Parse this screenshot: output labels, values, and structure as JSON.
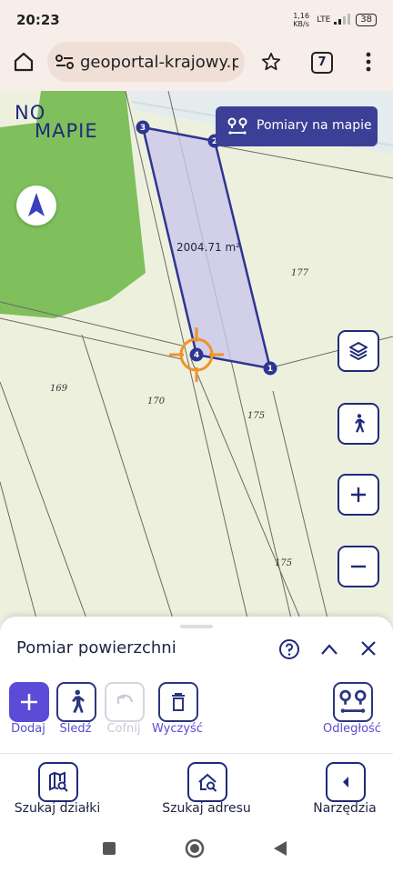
{
  "status_bar": {
    "time": "20:23",
    "net_speed": "1,16 KB/s",
    "network": "LTE",
    "battery": "38"
  },
  "browser": {
    "url": "geoportal-krajowy.pl/i",
    "tab_count": "7"
  },
  "map": {
    "logo_top": "NO",
    "logo_bottom": "MAPIE",
    "measure_button_label": "Pomiary na mapie",
    "area_label": "2004.71 m²",
    "vertex_labels": [
      "1",
      "2",
      "3",
      "4"
    ],
    "parcel_labels": [
      "177",
      "169",
      "170",
      "175",
      "175"
    ],
    "colors": {
      "polygon_stroke": "#2e3592",
      "polygon_fill": "#c9c8ea",
      "cursor": "#f0922a",
      "forest": "#7fbf5c"
    }
  },
  "panel": {
    "title": "Pomiar powierzchni",
    "tools": [
      {
        "label": "Dodaj"
      },
      {
        "label": "Śledź"
      },
      {
        "label": "Cofnij"
      },
      {
        "label": "Wyczyść"
      },
      {
        "label": "Odległość"
      }
    ]
  },
  "bottom_nav": [
    {
      "label": "Szukaj działki"
    },
    {
      "label": "Szukaj adresu"
    },
    {
      "label": "Narzędzia"
    }
  ]
}
